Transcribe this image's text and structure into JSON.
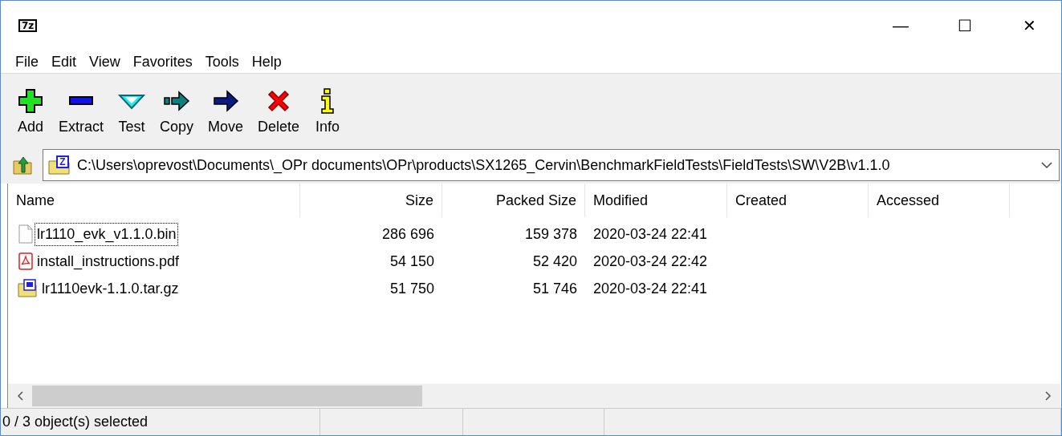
{
  "window": {
    "logo": "7z",
    "controls": [
      "—",
      "☐",
      "✕"
    ]
  },
  "menu": [
    "File",
    "Edit",
    "View",
    "Favorites",
    "Tools",
    "Help"
  ],
  "toolbar": [
    {
      "label": "Add",
      "kind": "add"
    },
    {
      "label": "Extract",
      "kind": "extract"
    },
    {
      "label": "Test",
      "kind": "test"
    },
    {
      "label": "Copy",
      "kind": "copy"
    },
    {
      "label": "Move",
      "kind": "move"
    },
    {
      "label": "Delete",
      "kind": "delete"
    },
    {
      "label": "Info",
      "kind": "info"
    }
  ],
  "address": {
    "badge": "Z",
    "value": "C:\\Users\\oprevost\\Documents\\_OPr documents\\OPr\\products\\SX1265_Cervin\\BenchmarkFieldTests\\FieldTests\\SW\\V2B\\v1.1.0"
  },
  "table": {
    "columns": [
      "Name",
      "Size",
      "Packed Size",
      "Modified",
      "Created",
      "Accessed"
    ],
    "rows": [
      {
        "kind": "file",
        "focused": true,
        "cells": [
          "lr1110_evk_v1.1.0.bin",
          "286 696",
          "159 378",
          "2020-03-24 22:41"
        ]
      },
      {
        "kind": "pdf",
        "focused": false,
        "cells": [
          "install_instructions.pdf",
          "54 150",
          "52 420",
          "2020-03-24 22:42"
        ]
      },
      {
        "kind": "archive",
        "focused": false,
        "cells": [
          "lr1110evk-1.1.0.tar.gz",
          "51 750",
          "51 746",
          "2020-03-24 22:41"
        ]
      }
    ]
  },
  "status_bar": [
    "0 / 3 object(s) selected"
  ]
}
